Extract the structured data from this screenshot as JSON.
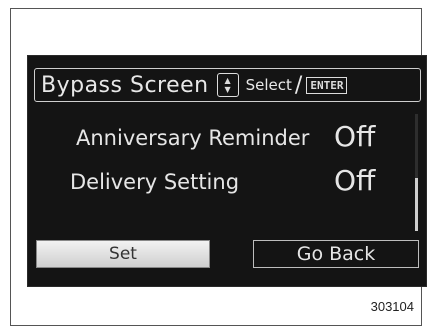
{
  "header": {
    "title": "Bypass Screen",
    "knob_up": "▲",
    "knob_down": "▼",
    "hint": "Select",
    "slash": "/",
    "enter": "ENTER"
  },
  "settings": [
    {
      "label": "Anniversary Reminder",
      "value": "Off"
    },
    {
      "label": "Delivery Setting",
      "value": "Off"
    }
  ],
  "scrollbar": {
    "thumb_start_fraction": 0.55,
    "thumb_size_fraction": 0.45
  },
  "buttons": {
    "set": "Set",
    "go_back": "Go Back"
  },
  "caption": "303104",
  "icons": {
    "knob": "rotary-knob-icon",
    "enter": "enter-key-icon"
  }
}
